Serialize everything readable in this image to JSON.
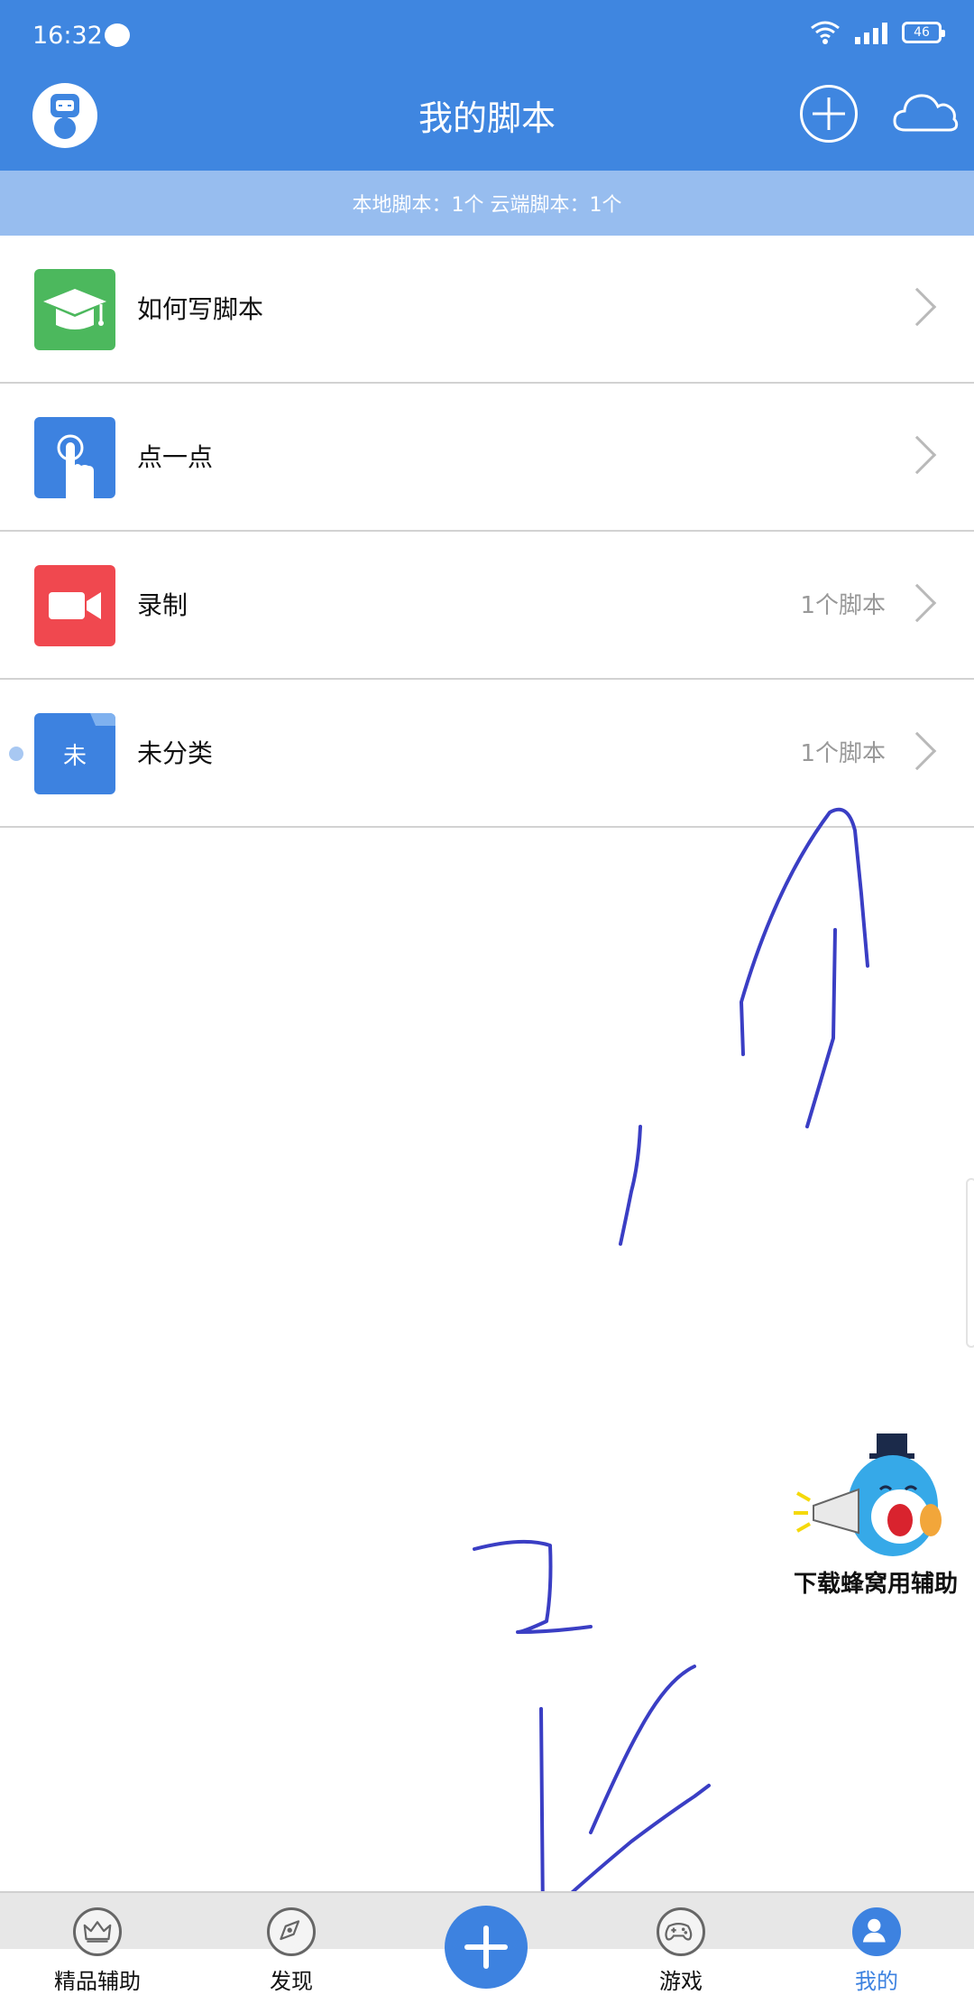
{
  "status": {
    "time": "16:32",
    "battery": "46",
    "icons": [
      "message-icon",
      "wifi-icon",
      "signal-icon",
      "battery-icon"
    ]
  },
  "header": {
    "title": "我的脚本",
    "summary": "本地脚本：1个 云端脚本：1个",
    "icons": [
      "robot-avatar-icon",
      "add-circle-icon",
      "cloud-icon"
    ]
  },
  "list": {
    "items": [
      {
        "label": "如何写脚本",
        "count": "",
        "icon": "graduation-cap-icon",
        "color": "#4cb85d"
      },
      {
        "label": "点一点",
        "count": "",
        "icon": "tap-hand-icon",
        "color": "#3d82e0"
      },
      {
        "label": "录制",
        "count": "1个脚本",
        "icon": "video-camera-icon",
        "color": "#f0484f"
      },
      {
        "label": "未分类",
        "count": "1个脚本",
        "icon": "folder-icon",
        "icon_text": "未",
        "color": "#3d82e0"
      }
    ]
  },
  "promo": {
    "text": "下载蜂窝用辅助"
  },
  "bottom_nav": {
    "tabs": [
      {
        "label": "精品辅助",
        "icon": "crown-icon"
      },
      {
        "label": "发现",
        "icon": "compass-icon"
      },
      {
        "label": "游戏",
        "icon": "gamepad-icon"
      },
      {
        "label": "我的",
        "icon": "user-icon",
        "active": true
      }
    ],
    "center_icon": "add-icon"
  },
  "annotation": {
    "label": "2",
    "color": "#3a3ec4"
  },
  "colors": {
    "primary": "#3f86e0",
    "subbar": "#97bdef",
    "accent": "#3d82e0"
  }
}
